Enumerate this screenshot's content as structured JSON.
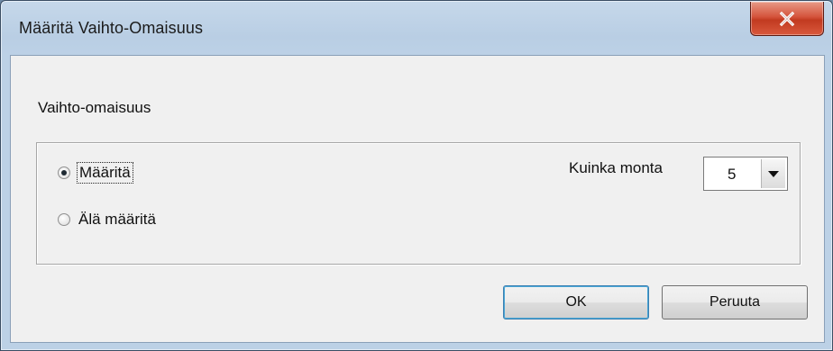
{
  "window": {
    "title": "Määritä Vaihto-Omaisuus",
    "close_label": "✕"
  },
  "section": {
    "title": "Vaihto-omaisuus"
  },
  "options": {
    "define_label": "Määritä",
    "define_selected": true,
    "dont_define_label": "Älä määritä",
    "dont_define_selected": false
  },
  "quantity": {
    "label": "Kuinka monta",
    "selected_value": "5"
  },
  "buttons": {
    "ok_label": "OK",
    "cancel_label": "Peruuta"
  },
  "colors": {
    "titlebar": "#bcd1e6",
    "close_button": "#d5543c",
    "client_background": "#f0f0f0",
    "default_button_border": "#3c7fb1"
  }
}
